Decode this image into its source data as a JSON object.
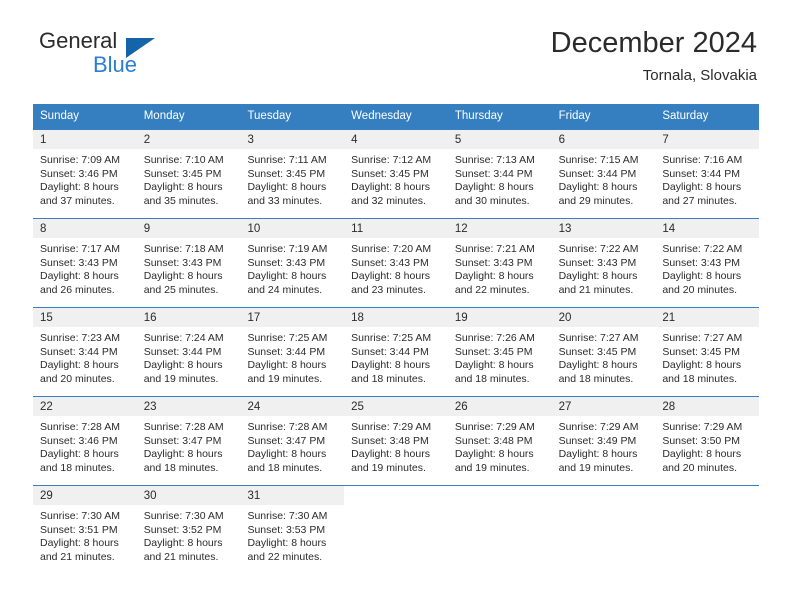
{
  "brand": {
    "name_part1": "General",
    "name_part2": "Blue",
    "triangle_color": "#1464aa",
    "blue_color": "#2a7fd4"
  },
  "header": {
    "title": "December 2024",
    "subtitle": "Tornala, Slovakia"
  },
  "theme": {
    "header_row_bg": "#357ec0",
    "header_row_text": "#ffffff",
    "daynum_bg": "#f0f0f0",
    "row_divider": "#3a7fc1",
    "text": "#2b2b2b"
  },
  "weekdays": [
    "Sunday",
    "Monday",
    "Tuesday",
    "Wednesday",
    "Thursday",
    "Friday",
    "Saturday"
  ],
  "weeks": [
    [
      {
        "day": "1",
        "sunrise": "Sunrise: 7:09 AM",
        "sunset": "Sunset: 3:46 PM",
        "daylight1": "Daylight: 8 hours",
        "daylight2": "and 37 minutes."
      },
      {
        "day": "2",
        "sunrise": "Sunrise: 7:10 AM",
        "sunset": "Sunset: 3:45 PM",
        "daylight1": "Daylight: 8 hours",
        "daylight2": "and 35 minutes."
      },
      {
        "day": "3",
        "sunrise": "Sunrise: 7:11 AM",
        "sunset": "Sunset: 3:45 PM",
        "daylight1": "Daylight: 8 hours",
        "daylight2": "and 33 minutes."
      },
      {
        "day": "4",
        "sunrise": "Sunrise: 7:12 AM",
        "sunset": "Sunset: 3:45 PM",
        "daylight1": "Daylight: 8 hours",
        "daylight2": "and 32 minutes."
      },
      {
        "day": "5",
        "sunrise": "Sunrise: 7:13 AM",
        "sunset": "Sunset: 3:44 PM",
        "daylight1": "Daylight: 8 hours",
        "daylight2": "and 30 minutes."
      },
      {
        "day": "6",
        "sunrise": "Sunrise: 7:15 AM",
        "sunset": "Sunset: 3:44 PM",
        "daylight1": "Daylight: 8 hours",
        "daylight2": "and 29 minutes."
      },
      {
        "day": "7",
        "sunrise": "Sunrise: 7:16 AM",
        "sunset": "Sunset: 3:44 PM",
        "daylight1": "Daylight: 8 hours",
        "daylight2": "and 27 minutes."
      }
    ],
    [
      {
        "day": "8",
        "sunrise": "Sunrise: 7:17 AM",
        "sunset": "Sunset: 3:43 PM",
        "daylight1": "Daylight: 8 hours",
        "daylight2": "and 26 minutes."
      },
      {
        "day": "9",
        "sunrise": "Sunrise: 7:18 AM",
        "sunset": "Sunset: 3:43 PM",
        "daylight1": "Daylight: 8 hours",
        "daylight2": "and 25 minutes."
      },
      {
        "day": "10",
        "sunrise": "Sunrise: 7:19 AM",
        "sunset": "Sunset: 3:43 PM",
        "daylight1": "Daylight: 8 hours",
        "daylight2": "and 24 minutes."
      },
      {
        "day": "11",
        "sunrise": "Sunrise: 7:20 AM",
        "sunset": "Sunset: 3:43 PM",
        "daylight1": "Daylight: 8 hours",
        "daylight2": "and 23 minutes."
      },
      {
        "day": "12",
        "sunrise": "Sunrise: 7:21 AM",
        "sunset": "Sunset: 3:43 PM",
        "daylight1": "Daylight: 8 hours",
        "daylight2": "and 22 minutes."
      },
      {
        "day": "13",
        "sunrise": "Sunrise: 7:22 AM",
        "sunset": "Sunset: 3:43 PM",
        "daylight1": "Daylight: 8 hours",
        "daylight2": "and 21 minutes."
      },
      {
        "day": "14",
        "sunrise": "Sunrise: 7:22 AM",
        "sunset": "Sunset: 3:43 PM",
        "daylight1": "Daylight: 8 hours",
        "daylight2": "and 20 minutes."
      }
    ],
    [
      {
        "day": "15",
        "sunrise": "Sunrise: 7:23 AM",
        "sunset": "Sunset: 3:44 PM",
        "daylight1": "Daylight: 8 hours",
        "daylight2": "and 20 minutes."
      },
      {
        "day": "16",
        "sunrise": "Sunrise: 7:24 AM",
        "sunset": "Sunset: 3:44 PM",
        "daylight1": "Daylight: 8 hours",
        "daylight2": "and 19 minutes."
      },
      {
        "day": "17",
        "sunrise": "Sunrise: 7:25 AM",
        "sunset": "Sunset: 3:44 PM",
        "daylight1": "Daylight: 8 hours",
        "daylight2": "and 19 minutes."
      },
      {
        "day": "18",
        "sunrise": "Sunrise: 7:25 AM",
        "sunset": "Sunset: 3:44 PM",
        "daylight1": "Daylight: 8 hours",
        "daylight2": "and 18 minutes."
      },
      {
        "day": "19",
        "sunrise": "Sunrise: 7:26 AM",
        "sunset": "Sunset: 3:45 PM",
        "daylight1": "Daylight: 8 hours",
        "daylight2": "and 18 minutes."
      },
      {
        "day": "20",
        "sunrise": "Sunrise: 7:27 AM",
        "sunset": "Sunset: 3:45 PM",
        "daylight1": "Daylight: 8 hours",
        "daylight2": "and 18 minutes."
      },
      {
        "day": "21",
        "sunrise": "Sunrise: 7:27 AM",
        "sunset": "Sunset: 3:45 PM",
        "daylight1": "Daylight: 8 hours",
        "daylight2": "and 18 minutes."
      }
    ],
    [
      {
        "day": "22",
        "sunrise": "Sunrise: 7:28 AM",
        "sunset": "Sunset: 3:46 PM",
        "daylight1": "Daylight: 8 hours",
        "daylight2": "and 18 minutes."
      },
      {
        "day": "23",
        "sunrise": "Sunrise: 7:28 AM",
        "sunset": "Sunset: 3:47 PM",
        "daylight1": "Daylight: 8 hours",
        "daylight2": "and 18 minutes."
      },
      {
        "day": "24",
        "sunrise": "Sunrise: 7:28 AM",
        "sunset": "Sunset: 3:47 PM",
        "daylight1": "Daylight: 8 hours",
        "daylight2": "and 18 minutes."
      },
      {
        "day": "25",
        "sunrise": "Sunrise: 7:29 AM",
        "sunset": "Sunset: 3:48 PM",
        "daylight1": "Daylight: 8 hours",
        "daylight2": "and 19 minutes."
      },
      {
        "day": "26",
        "sunrise": "Sunrise: 7:29 AM",
        "sunset": "Sunset: 3:48 PM",
        "daylight1": "Daylight: 8 hours",
        "daylight2": "and 19 minutes."
      },
      {
        "day": "27",
        "sunrise": "Sunrise: 7:29 AM",
        "sunset": "Sunset: 3:49 PM",
        "daylight1": "Daylight: 8 hours",
        "daylight2": "and 19 minutes."
      },
      {
        "day": "28",
        "sunrise": "Sunrise: 7:29 AM",
        "sunset": "Sunset: 3:50 PM",
        "daylight1": "Daylight: 8 hours",
        "daylight2": "and 20 minutes."
      }
    ],
    [
      {
        "day": "29",
        "sunrise": "Sunrise: 7:30 AM",
        "sunset": "Sunset: 3:51 PM",
        "daylight1": "Daylight: 8 hours",
        "daylight2": "and 21 minutes."
      },
      {
        "day": "30",
        "sunrise": "Sunrise: 7:30 AM",
        "sunset": "Sunset: 3:52 PM",
        "daylight1": "Daylight: 8 hours",
        "daylight2": "and 21 minutes."
      },
      {
        "day": "31",
        "sunrise": "Sunrise: 7:30 AM",
        "sunset": "Sunset: 3:53 PM",
        "daylight1": "Daylight: 8 hours",
        "daylight2": "and 22 minutes."
      },
      {
        "day": "",
        "sunrise": "",
        "sunset": "",
        "daylight1": "",
        "daylight2": ""
      },
      {
        "day": "",
        "sunrise": "",
        "sunset": "",
        "daylight1": "",
        "daylight2": ""
      },
      {
        "day": "",
        "sunrise": "",
        "sunset": "",
        "daylight1": "",
        "daylight2": ""
      },
      {
        "day": "",
        "sunrise": "",
        "sunset": "",
        "daylight1": "",
        "daylight2": ""
      }
    ]
  ]
}
